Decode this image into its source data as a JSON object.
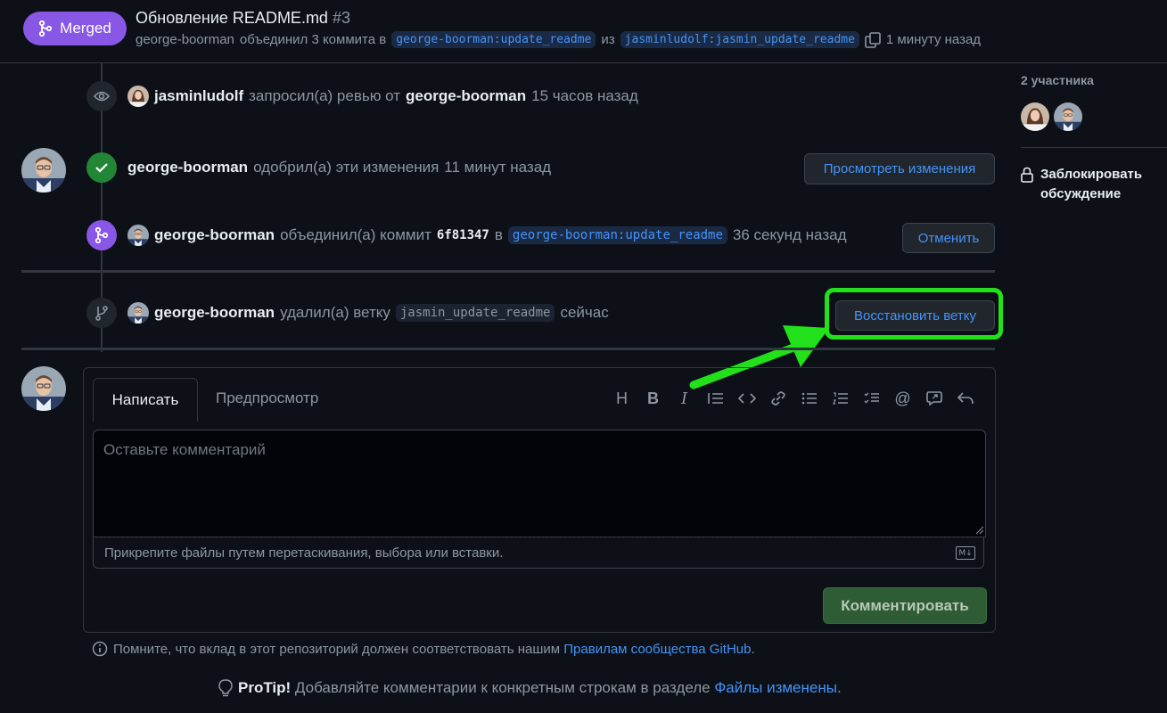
{
  "header": {
    "badge": "Merged",
    "title": "Обновление README.md",
    "number": "#3",
    "sub_user": "george-boorman",
    "sub_action": "объединил 3 коммита в",
    "base_branch": "george-boorman:update_readme",
    "from_word": "из",
    "head_branch": "jasminludolf:jasmin_update_readme",
    "time": "1 минуту назад"
  },
  "events": {
    "review_request": {
      "user": "jasminludolf",
      "action": "запросил(а) ревью от",
      "target": "george-boorman",
      "time": "15 часов назад"
    },
    "approve": {
      "user": "george-boorman",
      "action": "одобрил(а) эти изменения",
      "time": "11 минут назад",
      "button": "Просмотреть изменения"
    },
    "merge": {
      "user": "george-boorman",
      "action": "объединил(а) коммит",
      "commit": "6f81347",
      "in_word": "в",
      "branch": "george-boorman:update_readme",
      "time": "36 секунд назад",
      "button": "Отменить"
    },
    "delete_branch": {
      "user": "george-boorman",
      "action": "удалил(а) ветку",
      "branch": "jasmin_update_readme",
      "time": "сейчас",
      "button": "Восстановить ветку"
    }
  },
  "comment": {
    "tab_write": "Написать",
    "tab_preview": "Предпросмотр",
    "placeholder": "Оставьте комментарий",
    "attach_hint": "Прикрепите файлы путем перетаскивания, выбора или вставки.",
    "markdown_badge": "M↓",
    "submit": "Комментировать",
    "toolbar": [
      "heading-icon",
      "bold-icon",
      "italic-icon",
      "quote-icon",
      "code-icon",
      "link-icon",
      "bulleted-list-icon",
      "numbered-list-icon",
      "task-list-icon",
      "mention-icon",
      "cross-reference-icon",
      "reply-icon"
    ]
  },
  "footer": {
    "guidelines_text": "Помните, что вклад в этот репозиторий должен соответствовать нашим",
    "guidelines_link": "Правилам сообщества GitHub",
    "guidelines_end": ".",
    "protip_label": "ProTip!",
    "protip_text": "Добавляйте комментарии к конкретным строкам в разделе",
    "protip_link": "Файлы изменены",
    "protip_end": "."
  },
  "sidebar": {
    "participants": "2 участника",
    "lock": "Заблокировать обсуждение"
  },
  "colors": {
    "background": "#0d1117",
    "merged_purple": "#8957e5",
    "approve_green": "#238636",
    "link_blue": "#4493f8",
    "annotation_green": "#22e01a"
  }
}
